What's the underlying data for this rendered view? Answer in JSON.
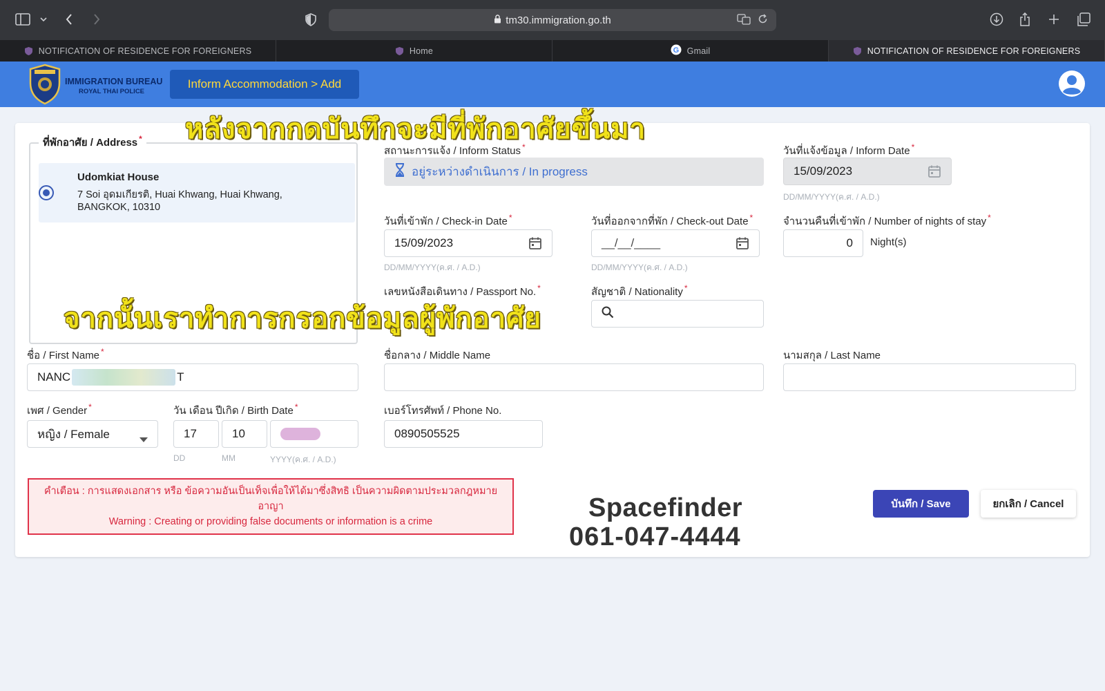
{
  "browser": {
    "url": "tm30.immigration.go.th",
    "tabs": [
      {
        "label": "NOTIFICATION OF RESIDENCE FOR FOREIGNERS",
        "active": false
      },
      {
        "label": "Home",
        "active": false
      },
      {
        "label": "Gmail",
        "active": false
      },
      {
        "label": "NOTIFICATION OF RESIDENCE FOR FOREIGNERS",
        "active": true
      }
    ]
  },
  "header": {
    "brand_line1": "IMMIGRATION BUREAU",
    "brand_line2": "ROYAL THAI POLICE",
    "breadcrumb": "Inform Accommodation > Add"
  },
  "overlays": {
    "top": "หลังจากกดบันทึกจะมีที่พักอาศัยขึ้นมา",
    "middle": "จากนั้นเราทำการกรอกข้อมูลผู้พักอาศัย"
  },
  "form": {
    "address_label": "ที่พักอาศัย / Address",
    "address": {
      "name": "Udomkiat House",
      "line1": "7 Soi อุดมเกียรติ, Huai Khwang, Huai Khwang,",
      "line2": "BANGKOK, 10310"
    },
    "inform_status_label": "สถานะการแจ้ง / Inform Status",
    "inform_status_value": "อยู่ระหว่างดำเนินการ / In progress",
    "inform_date_label": "วันที่แจ้งข้อมูล / Inform Date",
    "inform_date_value": "15/09/2023",
    "date_hint": "DD/MM/YYYY(ค.ศ. / A.D.)",
    "checkin_label": "วันที่เข้าพัก / Check-in Date",
    "checkin_value": "15/09/2023",
    "checkout_label": "วันที่ออกจากที่พัก / Check-out Date",
    "checkout_value": "__/__/____",
    "nights_label": "จำนวนคืนที่เข้าพัก / Number of nights of stay",
    "nights_value": "0",
    "nights_unit": "Night(s)",
    "passport_label": "เลขหนังสือเดินทาง / Passport No.",
    "nationality_label": "สัญชาติ / Nationality",
    "first_name_label": "ชื่อ / First Name",
    "first_name_value": "NANC",
    "first_name_value_end": "T",
    "middle_name_label": "ชื่อกลาง / Middle Name",
    "last_name_label": "นามสกุล / Last Name",
    "gender_label": "เพศ / Gender",
    "gender_value": "หญิง / Female",
    "birth_label": "วัน เดือน ปีเกิด / Birth Date",
    "birth_day": "17",
    "birth_month": "10",
    "birth_hint_dd": "DD",
    "birth_hint_mm": "MM",
    "birth_hint_yyyy": "YYYY(ค.ศ. / A.D.)",
    "phone_label": "เบอร์โทรศัพท์ / Phone No.",
    "phone_value": "0890505525",
    "req_mark": "*"
  },
  "warning": {
    "thai": "คำเตือน : การแสดงเอกสาร หรือ ข้อความอันเป็นเท็จเพื่อให้ได้มาซึ่งสิทธิ เป็นความผิดตามประมวลกฎหมายอาญา",
    "english": "Warning : Creating or providing false documents or information is a crime"
  },
  "promo": {
    "name": "Spacefinder",
    "phone": "061-047-4444"
  },
  "actions": {
    "save": "บันทึก / Save",
    "cancel": "ยกเลิก / Cancel"
  },
  "colors": {
    "header_blue": "#3f7ee0",
    "breadcrumb_bg": "#1f5ab8",
    "breadcrumb_text": "#ffd83a",
    "save_button": "#3b45b6",
    "warning_red": "#e0334a",
    "overlay_yellow": "#f1e21a"
  }
}
